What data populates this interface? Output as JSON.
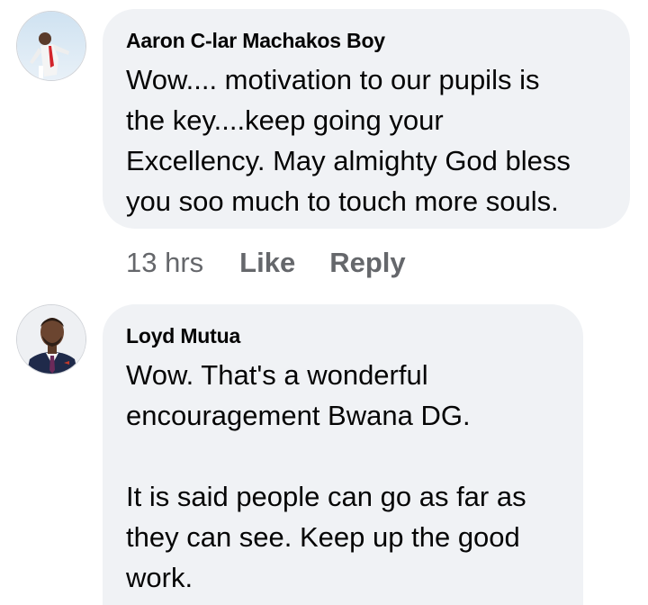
{
  "comments": [
    {
      "author": "Aaron C-lar Machakos Boy",
      "text": "Wow.... motivation to our pupils is\nthe key....keep going your\nExcellency. May almighty God bless\nyou soo much to touch more souls.",
      "time": "13 hrs",
      "like_label": "Like",
      "reply_label": "Reply"
    },
    {
      "author": "Loyd Mutua",
      "text": "Wow. That's a wonderful\nencouragement Bwana DG.\n\nIt is said people can go as far as\nthey can see. Keep up the good\nwork."
    }
  ],
  "colors": {
    "bubble_bg": "#f0f2f5",
    "meta_text": "#65676b",
    "text": "#050505"
  }
}
